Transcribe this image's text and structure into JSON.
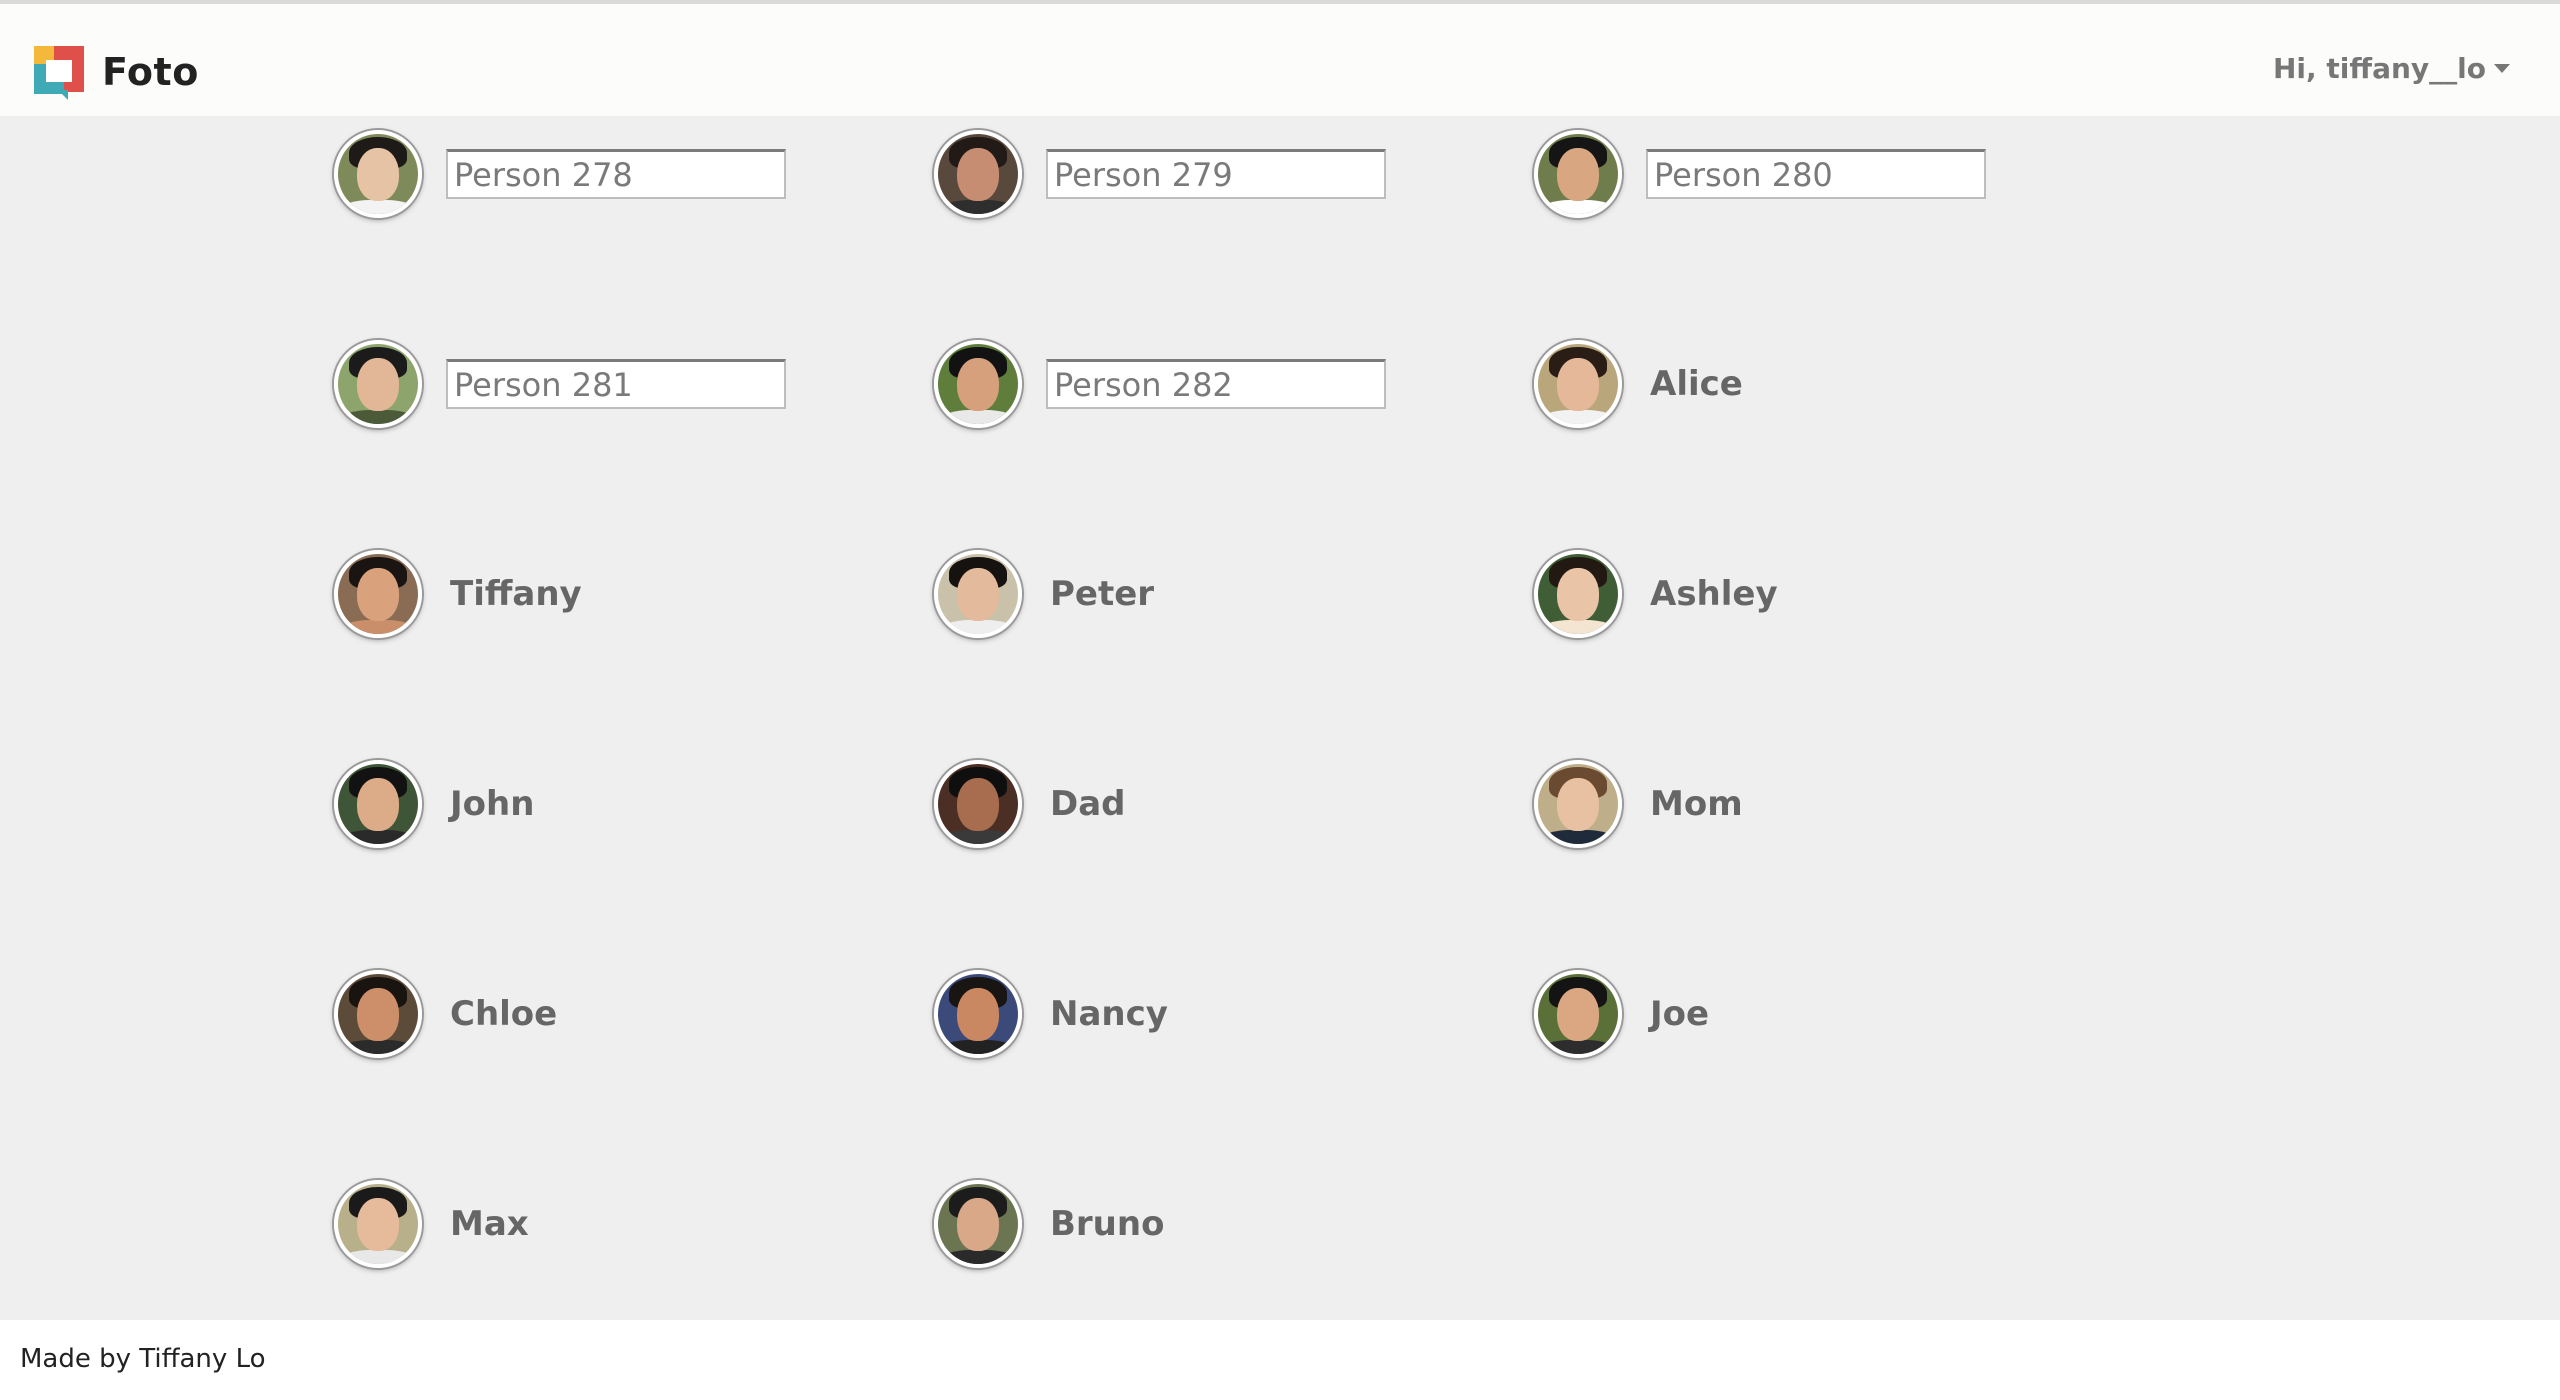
{
  "header": {
    "brand": "Foto",
    "user_greeting": "Hi, tiffany__lo"
  },
  "people": [
    {
      "kind": "input",
      "placeholder": "Person 278",
      "skin": "#e7c3a6",
      "hair": "#1e1a18",
      "bg": "#7f8a5a",
      "shirt": "#f3f3f3"
    },
    {
      "kind": "input",
      "placeholder": "Person 279",
      "skin": "#c68d73",
      "hair": "#221a17",
      "bg": "#59483c",
      "shirt": "#2e2e2e"
    },
    {
      "kind": "input",
      "placeholder": "Person 280",
      "skin": "#d8a782",
      "hair": "#151515",
      "bg": "#6f7c4c",
      "shirt": "#ffffff"
    },
    {
      "kind": "input",
      "placeholder": "Person 281",
      "skin": "#e2b797",
      "hair": "#1b1b1b",
      "bg": "#8da46d",
      "shirt": "#4b5b3a"
    },
    {
      "kind": "input",
      "placeholder": "Person 282",
      "skin": "#d6a07c",
      "hair": "#121212",
      "bg": "#5f7d3b",
      "shirt": "#e9e9e9"
    },
    {
      "kind": "label",
      "name": "Alice",
      "skin": "#e6b89a",
      "hair": "#2a1d16",
      "bg": "#b9a77b",
      "shirt": "#f2f2f2"
    },
    {
      "kind": "label",
      "name": "Tiffany",
      "skin": "#d9a27d",
      "hair": "#1a1412",
      "bg": "#8a6c55",
      "shirt": "#c98f6b"
    },
    {
      "kind": "label",
      "name": "Peter",
      "skin": "#e4ba9c",
      "hair": "#16120f",
      "bg": "#c9c1a9",
      "shirt": "#eeeeee"
    },
    {
      "kind": "label",
      "name": "Ashley",
      "skin": "#eac4a6",
      "hair": "#231913",
      "bg": "#3f5e35",
      "shirt": "#f4e5d2"
    },
    {
      "kind": "label",
      "name": "John",
      "skin": "#dcab88",
      "hair": "#121212",
      "bg": "#3e5537",
      "shirt": "#2a2a2a"
    },
    {
      "kind": "label",
      "name": "Dad",
      "skin": "#a86c4f",
      "hair": "#0f0f0f",
      "bg": "#4b2f24",
      "shirt": "#3a3a3a"
    },
    {
      "kind": "label",
      "name": "Mom",
      "skin": "#e8c0a2",
      "hair": "#6a4a30",
      "bg": "#bfae8a",
      "shirt": "#1f2a3a"
    },
    {
      "kind": "label",
      "name": "Chloe",
      "skin": "#cc8f6a",
      "hair": "#1a1411",
      "bg": "#5d4b39",
      "shirt": "#2b2b2b"
    },
    {
      "kind": "label",
      "name": "Nancy",
      "skin": "#c98762",
      "hair": "#191512",
      "bg": "#3c4a7a",
      "shirt": "#222222"
    },
    {
      "kind": "label",
      "name": "Joe",
      "skin": "#dba783",
      "hair": "#141414",
      "bg": "#5a7038",
      "shirt": "#2d2d2d"
    },
    {
      "kind": "label",
      "name": "Max",
      "skin": "#e6bb9c",
      "hair": "#1a1a1a",
      "bg": "#b7b08a",
      "shirt": "#e8e8e8"
    },
    {
      "kind": "label",
      "name": "Bruno",
      "skin": "#d9a889",
      "hair": "#1c1c1c",
      "bg": "#6c7552",
      "shirt": "#2a2a2a"
    }
  ],
  "footer": {
    "text": "Made by Tiffany Lo"
  }
}
